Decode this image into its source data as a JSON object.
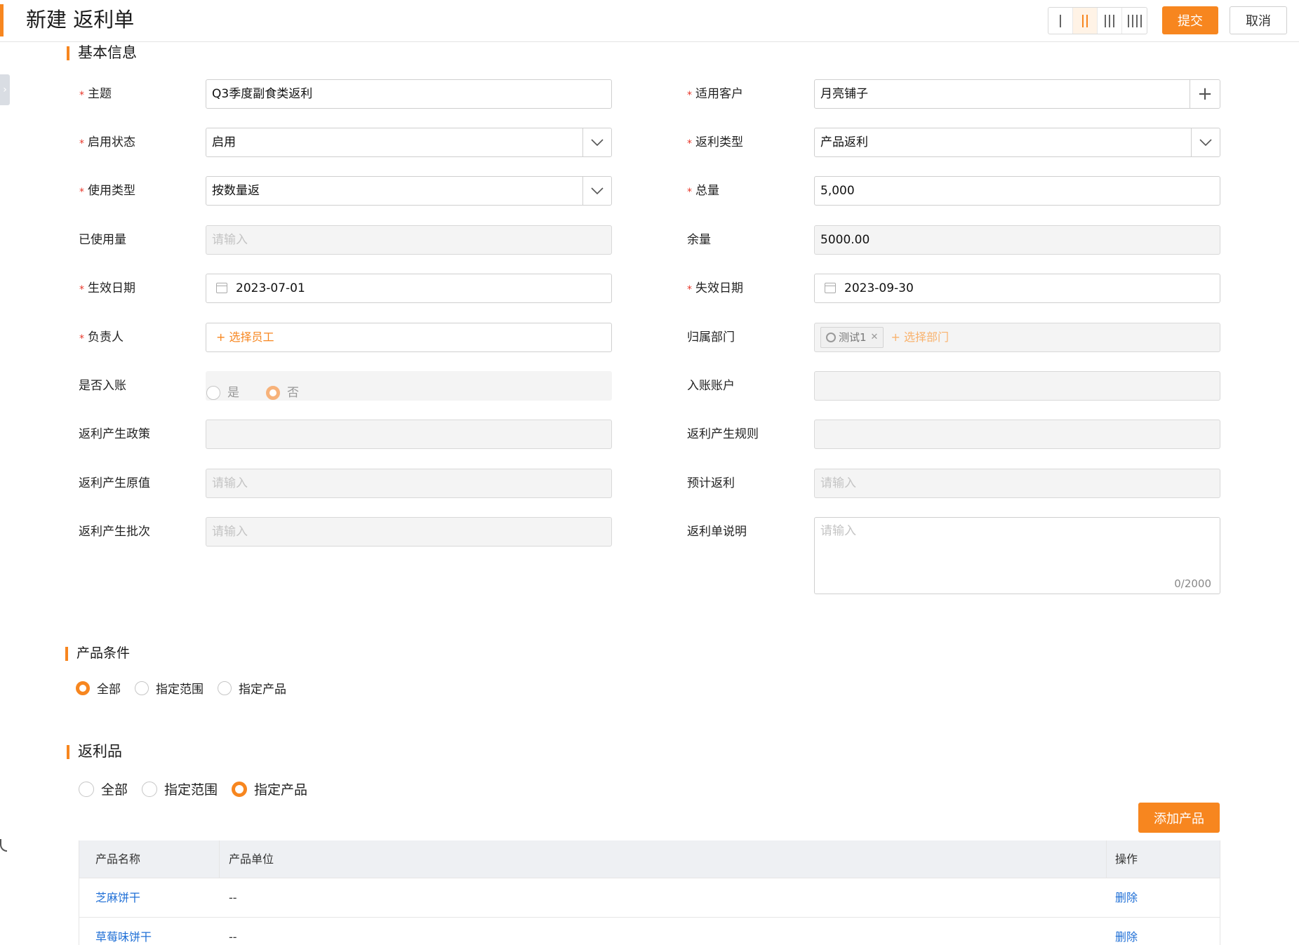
{
  "header": {
    "title": "新建 返利单",
    "submit_label": "提交",
    "cancel_label": "取消",
    "layout_options": [
      {
        "icon": "single-column-icon",
        "bars": 1,
        "active": false
      },
      {
        "icon": "two-column-icon",
        "bars": 2,
        "active": true
      },
      {
        "icon": "three-column-icon",
        "bars": 3,
        "active": false
      },
      {
        "icon": "four-column-icon",
        "bars": 4,
        "active": false
      }
    ]
  },
  "basic": {
    "section_title": "基本信息",
    "subject": {
      "label": "主题",
      "value": "Q3季度副食类返利"
    },
    "customer": {
      "label": "适用客户",
      "value": "月亮铺子"
    },
    "status": {
      "label": "启用状态",
      "value": "启用"
    },
    "rebate_type": {
      "label": "返利类型",
      "value": "产品返利"
    },
    "usage_type": {
      "label": "使用类型",
      "value": "按数量返"
    },
    "total": {
      "label": "总量",
      "value": "5,000"
    },
    "used": {
      "label": "已使用量",
      "placeholder": "请输入"
    },
    "remaining": {
      "label": "余量",
      "value": "5000.00"
    },
    "start_date": {
      "label": "生效日期",
      "value": "2023-07-01"
    },
    "end_date": {
      "label": "失效日期",
      "value": "2023-09-30"
    },
    "owner": {
      "label": "负责人",
      "action": "+ 选择员工"
    },
    "department": {
      "label": "归属部门",
      "tag": "测试1",
      "action": "+ 选择部门"
    },
    "posted": {
      "label": "是否入账",
      "yes": "是",
      "no": "否",
      "selected": "否"
    },
    "account": {
      "label": "入账账户"
    },
    "policy": {
      "label": "返利产生政策"
    },
    "rule": {
      "label": "返利产生规则"
    },
    "original_value": {
      "label": "返利产生原值",
      "placeholder": "请输入"
    },
    "expected": {
      "label": "预计返利",
      "placeholder": "请输入"
    },
    "batch": {
      "label": "返利产生批次",
      "placeholder": "请输入"
    },
    "description": {
      "label": "返利单说明",
      "placeholder": "请输入",
      "counter": "0/2000"
    }
  },
  "product_condition": {
    "section_title": "产品条件",
    "options": [
      "全部",
      "指定范围",
      "指定产品"
    ],
    "selected": "全部"
  },
  "rebate_products": {
    "section_title": "返利品",
    "options": [
      "全部",
      "指定范围",
      "指定产品"
    ],
    "selected": "指定产品",
    "add_label": "添加产品",
    "columns": [
      "产品名称",
      "产品单位",
      "操作"
    ],
    "rows": [
      {
        "name": "芝麻饼干",
        "unit": "--",
        "action": "删除"
      },
      {
        "name": "草莓味饼干",
        "unit": "--",
        "action": "删除"
      }
    ]
  },
  "colors": {
    "accent": "#f7861f",
    "link": "#1f6fd6",
    "required": "#e8372a"
  }
}
